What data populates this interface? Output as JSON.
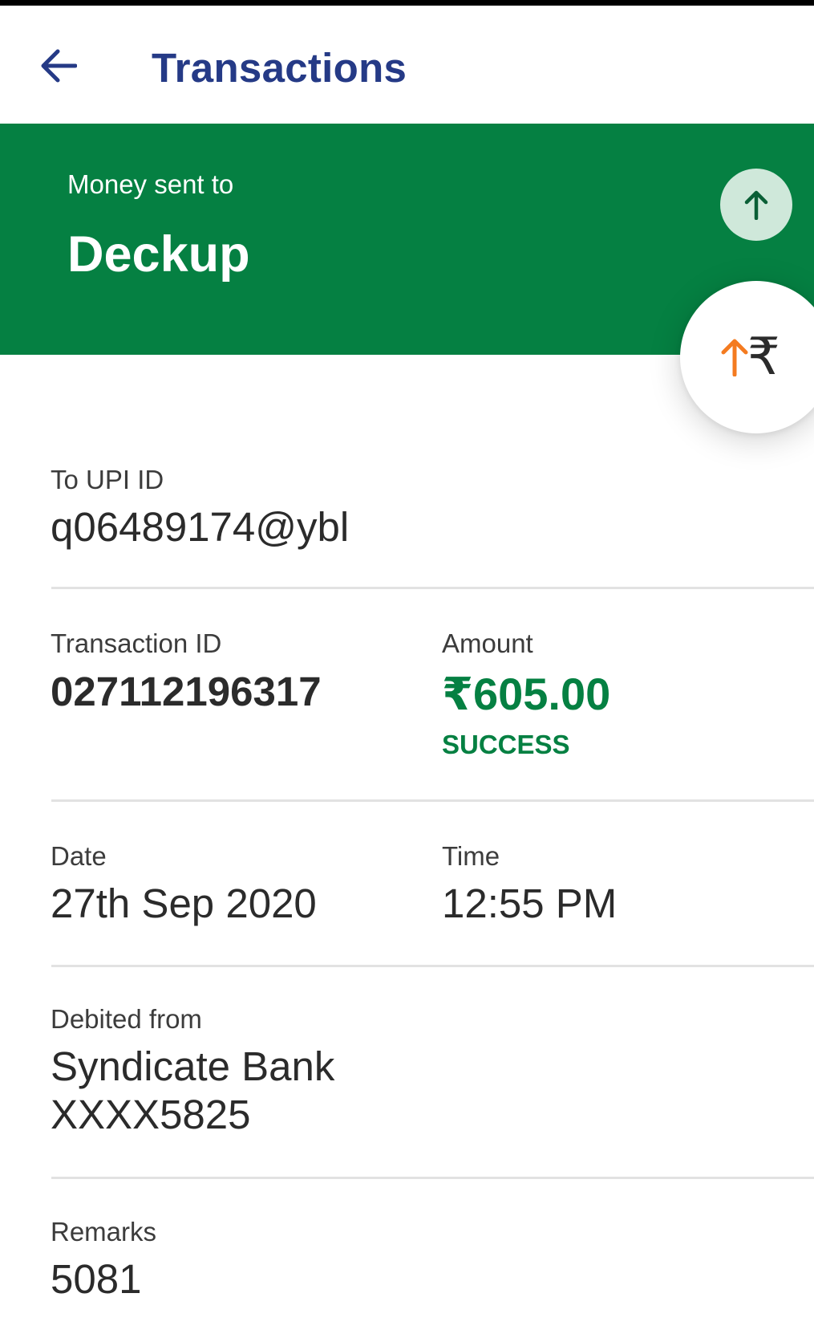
{
  "appbar": {
    "title": "Transactions",
    "back_icon": "arrow-left-icon"
  },
  "hero": {
    "subtitle": "Money sent to",
    "recipient": "Deckup",
    "direction_icon": "arrow-up-icon",
    "background_color": "#058042"
  },
  "fab": {
    "arrow_icon": "arrow-up-orange-icon",
    "rupee_symbol": "₹"
  },
  "details": {
    "upi": {
      "label": "To UPI ID",
      "value": "q06489174@ybl"
    },
    "transaction_id": {
      "label": "Transaction ID",
      "value": "027112196317"
    },
    "amount": {
      "label": "Amount",
      "value": "₹605.00",
      "status": "SUCCESS",
      "color": "#058042"
    },
    "date": {
      "label": "Date",
      "value": "27th Sep 2020"
    },
    "time": {
      "label": "Time",
      "value": "12:55 PM"
    },
    "debited_from": {
      "label": "Debited from",
      "bank": "Syndicate Bank",
      "account": "XXXX5825"
    },
    "remarks": {
      "label": "Remarks",
      "value": "5081"
    }
  },
  "colors": {
    "title_blue": "#253a86",
    "brand_green": "#058042",
    "accent_orange": "#f47b20"
  }
}
